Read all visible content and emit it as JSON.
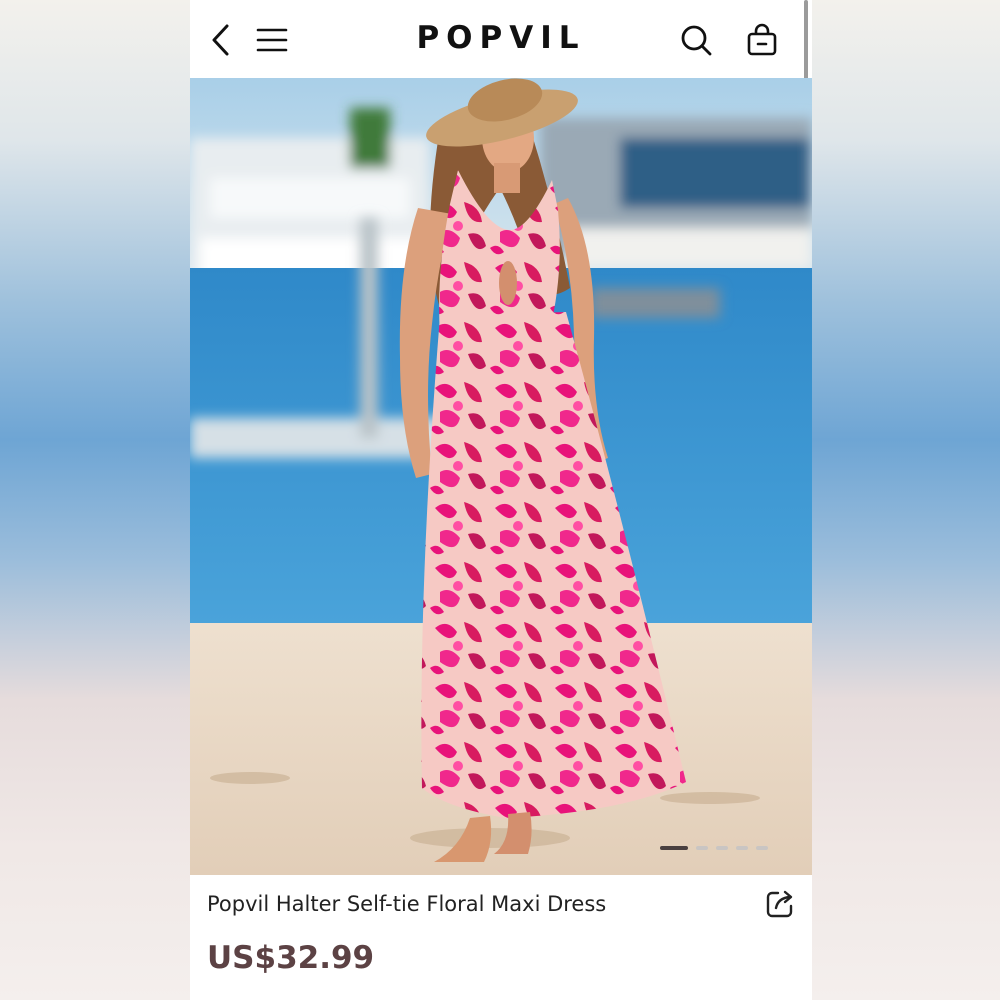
{
  "header": {
    "brand": "POPVIL",
    "icons": [
      "back-icon",
      "menu-icon",
      "search-icon",
      "bag-icon"
    ]
  },
  "gallery": {
    "image_alt": "Model on beach wearing pink floral halter maxi dress",
    "dot_count": 5,
    "active_dot": 1
  },
  "product": {
    "title": "Popvil Halter Self-tie Floral Maxi Dress",
    "price": "US$32.99"
  },
  "colors": {
    "price": "#5c4244",
    "dress_pink": "#e8137a",
    "dress_base": "#f6c9c4"
  }
}
